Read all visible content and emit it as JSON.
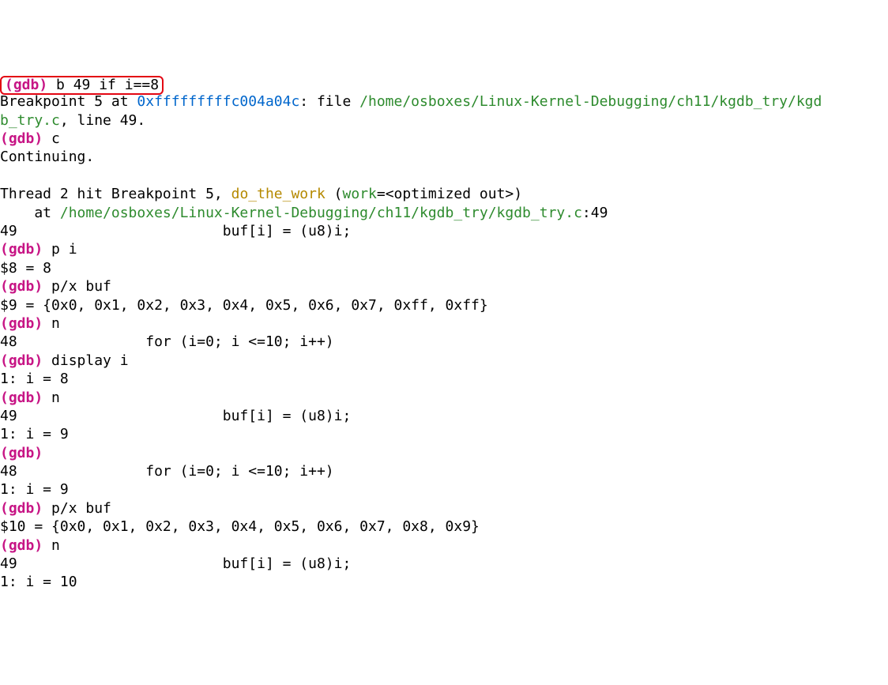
{
  "highlight": {
    "prompt": "(gdb) ",
    "cmd": "b 49 if i==8"
  },
  "l1": {
    "pre": "Breakpoint 5 at ",
    "addr": "0xfffffffffc004a04c",
    "mid": ": file ",
    "path": "/home/osboxes/Linux-Kernel-Debugging/ch11/kgdb_try/kgd"
  },
  "l2": {
    "path": "b_try.c",
    "post": ", line 49."
  },
  "l3": {
    "prompt": "(gdb) ",
    "cmd": "c"
  },
  "l4": "Continuing.",
  "blank1": "",
  "l5": {
    "pre": "Thread 2 hit Breakpoint 5, ",
    "func": "do_the_work",
    "open": " (",
    "argname": "work",
    "eq": "=<optimized out>)"
  },
  "l6": {
    "pre": "    at ",
    "path": "/home/osboxes/Linux-Kernel-Debugging/ch11/kgdb_try/kgdb_try.c",
    "colon": ":",
    "line": "49"
  },
  "l7": "49                        buf[i] = (u8)i;",
  "l8": {
    "prompt": "(gdb) ",
    "cmd": "p i"
  },
  "l9": "$8 = 8",
  "l10": {
    "prompt": "(gdb) ",
    "cmd": "p/x buf"
  },
  "l11": "$9 = {0x0, 0x1, 0x2, 0x3, 0x4, 0x5, 0x6, 0x7, 0xff, 0xff}",
  "l12": {
    "prompt": "(gdb) ",
    "cmd": "n"
  },
  "l13": "48               for (i=0; i <=10; i++)",
  "l14": {
    "prompt": "(gdb) ",
    "cmd": "display i"
  },
  "l15": "1: i = 8",
  "l16": {
    "prompt": "(gdb) ",
    "cmd": "n"
  },
  "l17": "49                        buf[i] = (u8)i;",
  "l18": "1: i = 9",
  "l19": {
    "prompt": "(gdb) ",
    "cmd": ""
  },
  "l20": "48               for (i=0; i <=10; i++)",
  "l21": "1: i = 9",
  "l22": {
    "prompt": "(gdb) ",
    "cmd": "p/x buf"
  },
  "l23": "$10 = {0x0, 0x1, 0x2, 0x3, 0x4, 0x5, 0x6, 0x7, 0x8, 0x9}",
  "l24": {
    "prompt": "(gdb) ",
    "cmd": "n"
  },
  "l25": "49                        buf[i] = (u8)i;",
  "l26": "1: i = 10"
}
